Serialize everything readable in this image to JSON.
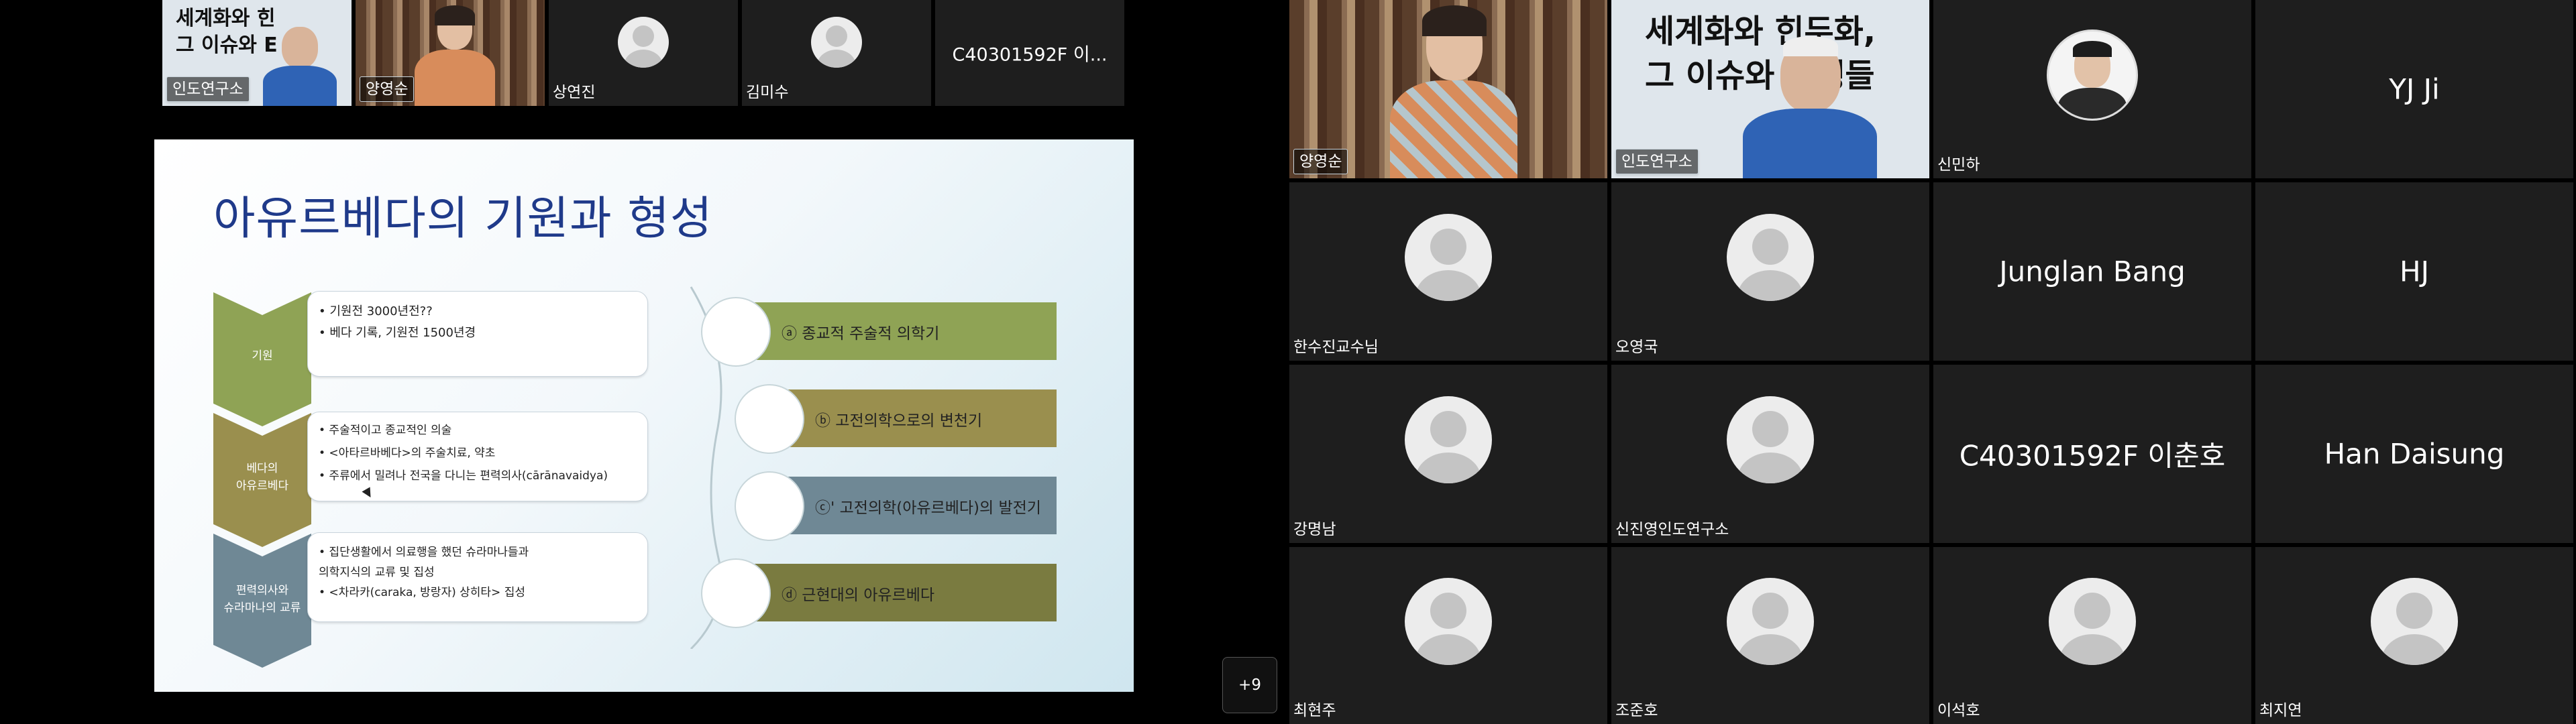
{
  "left_strip": [
    {
      "name": "인도연구소",
      "kind": "video-banner"
    },
    {
      "name": "양영순",
      "kind": "video-woman"
    },
    {
      "name": "상연진",
      "kind": "avatar"
    },
    {
      "name": "김미수",
      "kind": "avatar"
    },
    {
      "name": "",
      "title": "C40301592F 이..."
    }
  ],
  "slide": {
    "title": "아유르베다의 기원과 형성",
    "left_items": [
      {
        "label": "기원",
        "bullets": [
          "• 기원전 3000년전??",
          "• 베다 기록, 기원전 1500년경"
        ]
      },
      {
        "label": "베다의\n아유르베다",
        "bullets": [
          "• 주술적이고 종교적인 의술",
          "• <아타르바베다>의 주술치료, 약초",
          "• 주류에서 밀려나 전국을 다니는 편력의사(cārānavaidya)"
        ]
      },
      {
        "label": "편력의사와\n슈라마나의 교류",
        "bullets": [
          "• 집단생활에서 의료행을 했던 슈라마나들과\n   의학지식의 교류 및 집성",
          "• <차라카(caraka, 방랑자) 상히타> 집성"
        ]
      }
    ],
    "right_items": [
      {
        "text": "ⓐ 종교적 주술적 의학기",
        "color": "#8fa355"
      },
      {
        "text": "ⓑ 고전의학으로의 변천기",
        "color": "#9a8f4e"
      },
      {
        "text": "ⓒ' 고전의학(아유르베다)의 발전기",
        "color": "#6f8895"
      },
      {
        "text": "ⓓ 근현대의 아유르베다",
        "color": "#7a7b40"
      }
    ]
  },
  "overflow_button": "+9",
  "right_grid": [
    {
      "name": "양영순",
      "kind": "video-woman"
    },
    {
      "name": "인도연구소",
      "kind": "video-banner"
    },
    {
      "name": "신민하",
      "kind": "photo"
    },
    {
      "name": "",
      "title": "YJ Ji"
    },
    {
      "name": "한수진교수님",
      "kind": "avatar"
    },
    {
      "name": "오영국",
      "kind": "avatar"
    },
    {
      "name": "",
      "title": "Junglan Bang"
    },
    {
      "name": "",
      "title": "HJ"
    },
    {
      "name": "강명남",
      "kind": "avatar"
    },
    {
      "name": "신진영인도연구소",
      "kind": "avatar"
    },
    {
      "name": "",
      "title": "C40301592F 이춘호"
    },
    {
      "name": "",
      "title": "Han Daisung"
    },
    {
      "name": "최현주",
      "kind": "avatar"
    },
    {
      "name": "조준호",
      "kind": "avatar"
    },
    {
      "name": "이석호",
      "kind": "avatar"
    },
    {
      "name": "최지연",
      "kind": "avatar"
    }
  ],
  "banner_text": {
    "line1": "세계화와 힌두화,",
    "line2": "그 이슈와 논쟁들",
    "line1_short": "세계화와 힌",
    "line2_short": "그 이슈와 E"
  },
  "colors": {
    "tile_bg": "#1e1e1e",
    "slide_title": "#1f3a8a",
    "chevron_green": "#8fa355",
    "chevron_olive": "#9a8f4e",
    "chevron_slate": "#6f8895"
  }
}
